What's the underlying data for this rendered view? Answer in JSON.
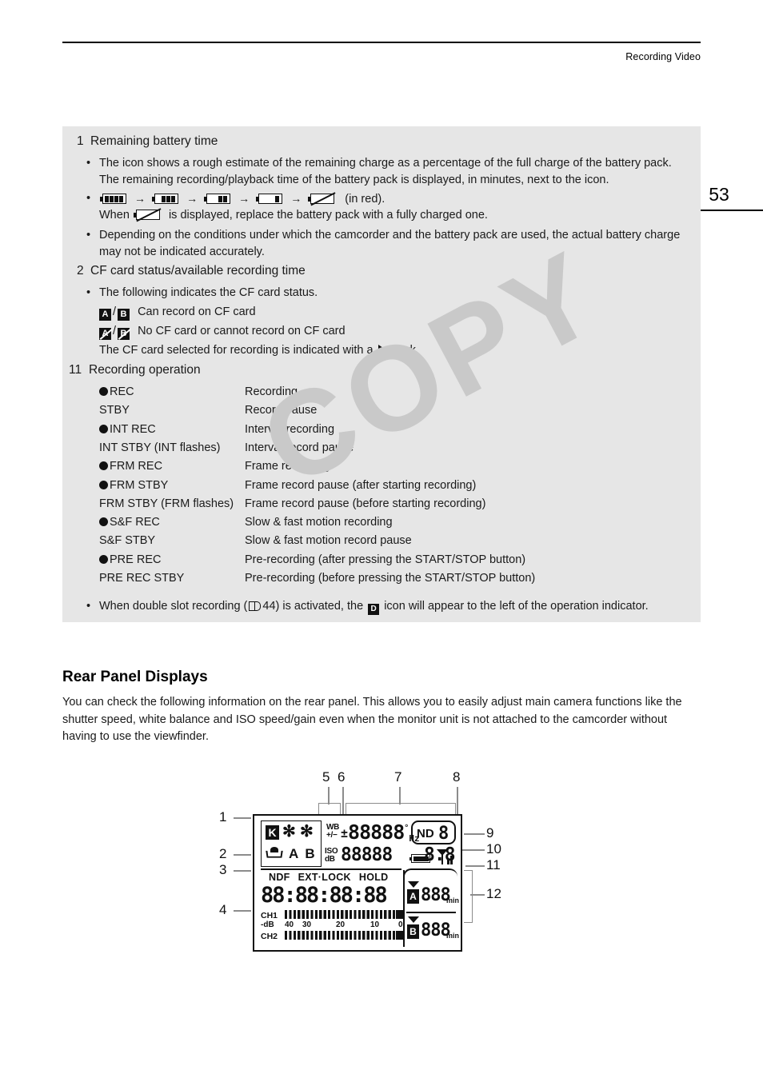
{
  "header": {
    "running_head": "Recording Video",
    "page_number": "53"
  },
  "watermark": "COPY",
  "info_box": {
    "sections": [
      {
        "number": "1",
        "title": "Remaining battery time"
      },
      {
        "number": "2",
        "title": "CF card status/available recording time"
      },
      {
        "number": "11",
        "title": "Recording operation"
      }
    ],
    "battery_bullet1": "The icon shows a rough estimate of the remaining charge as a percentage of the full charge of the battery pack. The remaining recording/playback time of the battery pack is displayed, in minutes, next to the icon.",
    "battery_icons_suffix": "(in red).",
    "battery_when_line_a": "When",
    "battery_when_line_b": "is displayed, replace the battery pack with a fully charged one.",
    "battery_bullet3": "Depending on the conditions under which the camcorder and the battery pack are used, the actual battery charge may not be indicated accurately.",
    "cf_bullet": "The following indicates the CF card status.",
    "cf_ok_a": "A",
    "cf_ok_b": "B",
    "cf_ok_text": "Can record on CF card",
    "cf_no_a": "A",
    "cf_no_b": "B",
    "cf_no_text": "No CF card or cannot record on CF card",
    "cf_selected_pre": "The CF card selected for recording is indicated with a",
    "cf_selected_post": "mark.",
    "double_slot_pre": "When double slot recording (",
    "double_slot_page": "44",
    "double_slot_mid": ") is activated, the",
    "double_slot_icon_label": "D",
    "double_slot_post": "icon will appear to the left of the operation indicator."
  },
  "recording_operations": [
    {
      "dot": true,
      "indicator": "REC",
      "meaning": "Recording"
    },
    {
      "dot": false,
      "indicator": "STBY",
      "meaning": "Record pause"
    },
    {
      "dot": true,
      "indicator": "INT REC",
      "meaning": "Interval recording"
    },
    {
      "dot": false,
      "indicator": "INT STBY (INT flashes)",
      "meaning": "Interval record pause"
    },
    {
      "dot": true,
      "indicator": "FRM REC",
      "meaning": "Frame recording"
    },
    {
      "dot": true,
      "indicator": "FRM STBY",
      "meaning": "Frame record pause (after starting recording)"
    },
    {
      "dot": false,
      "indicator": "FRM STBY (FRM flashes)",
      "meaning": "Frame record pause (before starting recording)"
    },
    {
      "dot": true,
      "indicator": "S&F REC",
      "meaning": "Slow & fast motion recording"
    },
    {
      "dot": false,
      "indicator": "S&F STBY",
      "meaning": "Slow & fast motion record pause"
    },
    {
      "dot": true,
      "indicator": "PRE REC",
      "meaning": "Pre-recording (after pressing the START/STOP button)"
    },
    {
      "dot": false,
      "indicator": "PRE REC STBY",
      "meaning": "Pre-recording (before pressing the START/STOP button)"
    }
  ],
  "rear_panel": {
    "title": "Rear Panel Displays",
    "body": "You can check the following information on the rear panel. This allows you to easily adjust main camera functions like the shutter speed, white balance and ISO speed/gain even when the monitor unit is not attached to the camcorder without having to use the viewfinder."
  },
  "lcd_diagram": {
    "callouts": [
      "1",
      "2",
      "3",
      "4",
      "5",
      "6",
      "7",
      "8",
      "9",
      "10",
      "11",
      "12"
    ],
    "wb_block": {
      "kelvin_label": "K",
      "ab_label": "A B"
    },
    "wb_adjust_label_line1": "WB",
    "wb_adjust_label_line2": "+/−",
    "iso_label_line1": "ISO",
    "iso_label_line2": "dB",
    "shutter_row": {
      "sign": "±",
      "digits": "88888",
      "degree": "°",
      "hz": "Hz"
    },
    "iso_row_digits": "88888",
    "aperture_digits": "8.8",
    "nd_filter": {
      "label": "ND",
      "value": "8"
    },
    "timecode_flags": [
      "NDF",
      "EXT·LOCK",
      "HOLD"
    ],
    "timecode": "88:88:88:88",
    "audio": {
      "ch1_label": "CH1",
      "ch2_label": "CH2",
      "scale_unit": "-dB",
      "scale_ticks": [
        "40",
        "30",
        "20",
        "10",
        "0"
      ]
    },
    "cf_remaining": [
      {
        "slot": "A",
        "value": "888",
        "unit": "min"
      },
      {
        "slot": "B",
        "value": "888",
        "unit": "min"
      }
    ]
  }
}
